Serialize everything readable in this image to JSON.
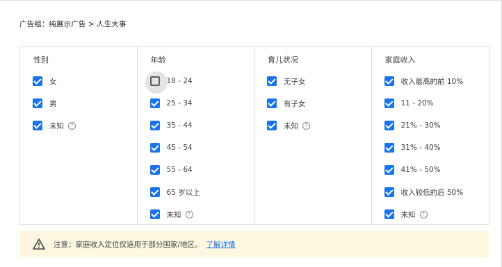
{
  "breadcrumb": "广告组：纯展示广告 > 人生大事",
  "columns": [
    {
      "header": "性别",
      "options": [
        {
          "label": "女",
          "checked": true
        },
        {
          "label": "男",
          "checked": true
        },
        {
          "label": "未知",
          "checked": true,
          "help": "?"
        }
      ]
    },
    {
      "header": "年龄",
      "options": [
        {
          "label": "18 - 24",
          "checked": false
        },
        {
          "label": "25 - 34",
          "checked": true
        },
        {
          "label": "35 - 44",
          "checked": true
        },
        {
          "label": "45 - 54",
          "checked": true
        },
        {
          "label": "55 - 64",
          "checked": true
        },
        {
          "label": "65 岁以上",
          "checked": true
        },
        {
          "label": "未知",
          "checked": true,
          "help": "?"
        }
      ]
    },
    {
      "header": "育儿状况",
      "options": [
        {
          "label": "无子女",
          "checked": true
        },
        {
          "label": "有子女",
          "checked": true
        },
        {
          "label": "未知",
          "checked": true,
          "help": "?"
        }
      ]
    },
    {
      "header": "家庭收入",
      "options": [
        {
          "label": "收入最高的前 10%",
          "checked": true
        },
        {
          "label": "11 - 20%",
          "checked": true
        },
        {
          "label": "21% - 30%",
          "checked": true
        },
        {
          "label": "31% - 40%",
          "checked": true
        },
        {
          "label": "41% - 50%",
          "checked": true
        },
        {
          "label": "收入较低的后 50%",
          "checked": true
        },
        {
          "label": "未知",
          "checked": true,
          "help": "?"
        }
      ]
    }
  ],
  "notice": {
    "text": "注意：家庭收入定位仅适用于部分国家/地区。",
    "link": "了解详情",
    "icon": "warning-icon"
  },
  "colors": {
    "accent": "#1a73e8",
    "warning": "#f9ab00",
    "notice_bg": "#fef7e0"
  }
}
